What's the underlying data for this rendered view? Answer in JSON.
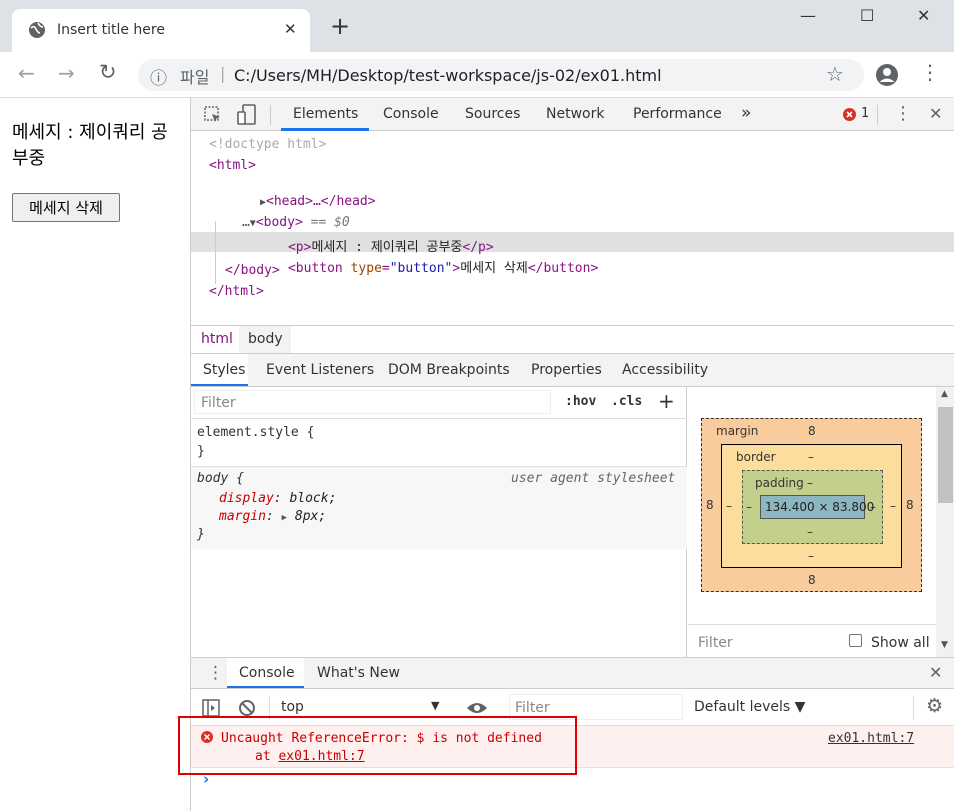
{
  "window": {
    "tab_title": "Insert title here",
    "new_tab": "+",
    "controls": {
      "minimize": "—",
      "maximize": "☐",
      "close": "✕"
    }
  },
  "toolbar": {
    "back": "←",
    "forward": "→",
    "reload": "↻",
    "info": "ⓘ",
    "scheme_label": "파일",
    "separator": "|",
    "url": "C:/Users/MH/Desktop/test-workspace/js-02/ex01.html",
    "star": "☆",
    "menu": "⋮"
  },
  "page": {
    "message": "메세지 : 제이쿼리 공부중",
    "button_label": "메세지 삭제"
  },
  "devtools": {
    "tabs": [
      "Elements",
      "Console",
      "Sources",
      "Network",
      "Performance"
    ],
    "more": "»",
    "error_count": "1",
    "close": "✕",
    "kebab": "⋮",
    "dom": {
      "doctype": "<!doctype html>",
      "html_open": "<html>",
      "head": "<head>…</head>",
      "body_open": "<body>",
      "body_eq": "== $0",
      "p_open": "<p>",
      "p_text": "메세지 : 제이쿼리 공부중",
      "p_close": "</p>",
      "button_open": "<button ",
      "button_attr": "type",
      "button_eq": "=",
      "button_val": "\"button\"",
      "button_gt": ">",
      "button_text": "메세지 삭제",
      "button_close": "</button>",
      "body_close": "</body>",
      "html_close": "</html>",
      "ellipsis": "…"
    },
    "breadcrumbs": [
      "html",
      "body"
    ],
    "subtabs": [
      "Styles",
      "Event Listeners",
      "DOM Breakpoints",
      "Properties",
      "Accessibility"
    ],
    "styles": {
      "filter_placeholder": "Filter",
      "hov": ":hov",
      "cls": ".cls",
      "plus": "+",
      "element_style": "element.style {",
      "close_brace": "}",
      "body_selector": "body {",
      "ua": "user agent stylesheet",
      "prop1_name": "display",
      "prop1_value": "block;",
      "prop2_name": "margin",
      "prop2_value": "8px;"
    },
    "box_model": {
      "margin_label": "margin",
      "margin_top": "8",
      "margin_left": "8",
      "margin_right": "8",
      "margin_bottom": "8",
      "border_label": "border",
      "border_value": "–",
      "padding_label": "padding",
      "padding_value": "–",
      "content": "134.400 × 83.800",
      "filter_placeholder": "Filter",
      "show_all": "Show all"
    },
    "drawer": {
      "tabs": [
        "Console",
        "What's New"
      ],
      "context": "top",
      "filter_placeholder": "Filter",
      "levels": "Default levels ▼"
    },
    "console": {
      "error_line1": "Uncaught ReferenceError: $ is not defined",
      "error_line2_prefix": "at ",
      "error_line2_link": "ex01.html:7",
      "source_link": "ex01.html:7",
      "prompt": "›"
    }
  },
  "colors": {
    "accent": "#1a73e8",
    "error": "#c80000",
    "highlight_box": "#e00000"
  }
}
